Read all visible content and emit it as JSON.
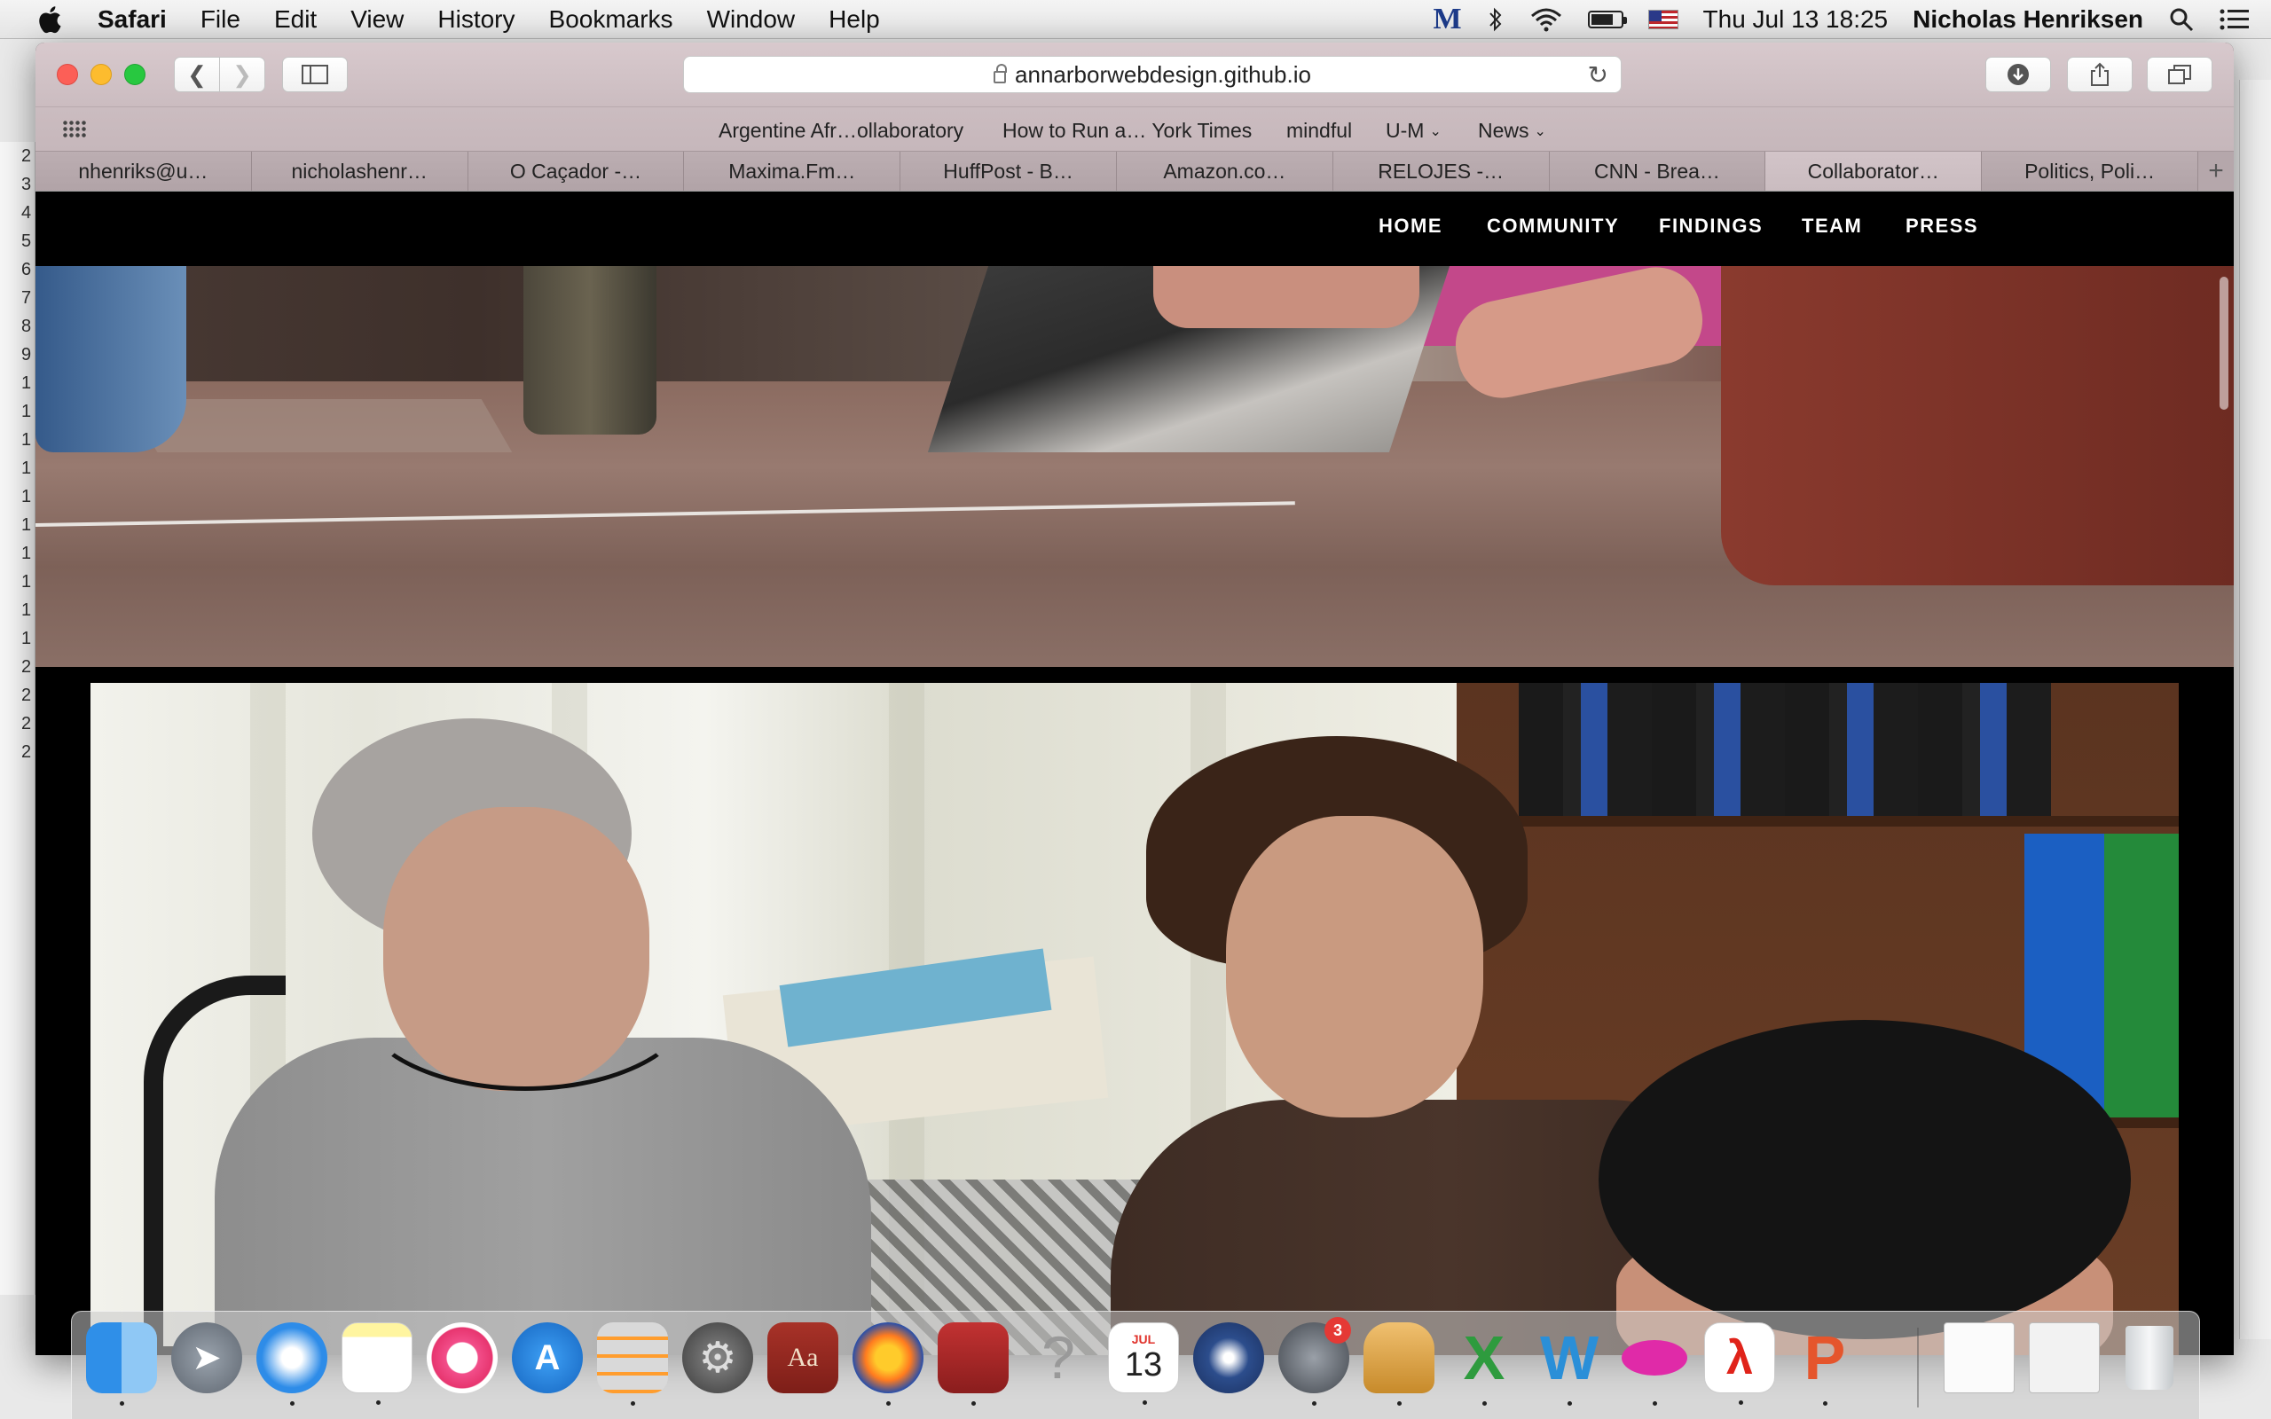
{
  "menubar": {
    "app_name": "Safari",
    "items": [
      "File",
      "Edit",
      "View",
      "History",
      "Bookmarks",
      "Window",
      "Help"
    ],
    "clock": "Thu Jul 13  18:25",
    "user": "Nicholas Henriksen"
  },
  "browser": {
    "url": "annarborwebdesign.github.io",
    "favorites": [
      {
        "label": "Argentine Afr…ollaboratory",
        "has_menu": false
      },
      {
        "label": "How to Run a… York Times",
        "has_menu": false
      },
      {
        "label": "mindful",
        "has_menu": false
      },
      {
        "label": "U-M",
        "has_menu": true
      },
      {
        "label": "News",
        "has_menu": true
      }
    ],
    "tabs": [
      {
        "label": "nhenriks@u…",
        "active": false
      },
      {
        "label": "nicholashenr…",
        "active": false
      },
      {
        "label": "O Caçador -…",
        "active": false
      },
      {
        "label": "Maxima.Fm…",
        "active": false
      },
      {
        "label": "HuffPost - B…",
        "active": false
      },
      {
        "label": "Amazon.co…",
        "active": false
      },
      {
        "label": "RELOJES -…",
        "active": false
      },
      {
        "label": "CNN - Brea…",
        "active": false
      },
      {
        "label": "Collaborator…",
        "active": true
      },
      {
        "label": "Politics, Poli…",
        "active": false
      }
    ],
    "new_tab_label": "+"
  },
  "site": {
    "nav": [
      "HOME",
      "COMMUNITY",
      "FINDINGS",
      "TEAM",
      "PRESS"
    ]
  },
  "dock": {
    "calendar_month": "JUL",
    "calendar_day": "13",
    "notification_badge": "3",
    "dictionary_label": "Aa",
    "help_label": "?"
  },
  "background_window": {
    "row_labels": [
      "2",
      "3",
      "4",
      "5",
      "6",
      "7",
      "8",
      "9",
      "1",
      "1",
      "1",
      "1",
      "1",
      "1",
      "1",
      "1",
      "1",
      "1",
      "2",
      "2",
      "2",
      "2"
    ]
  }
}
